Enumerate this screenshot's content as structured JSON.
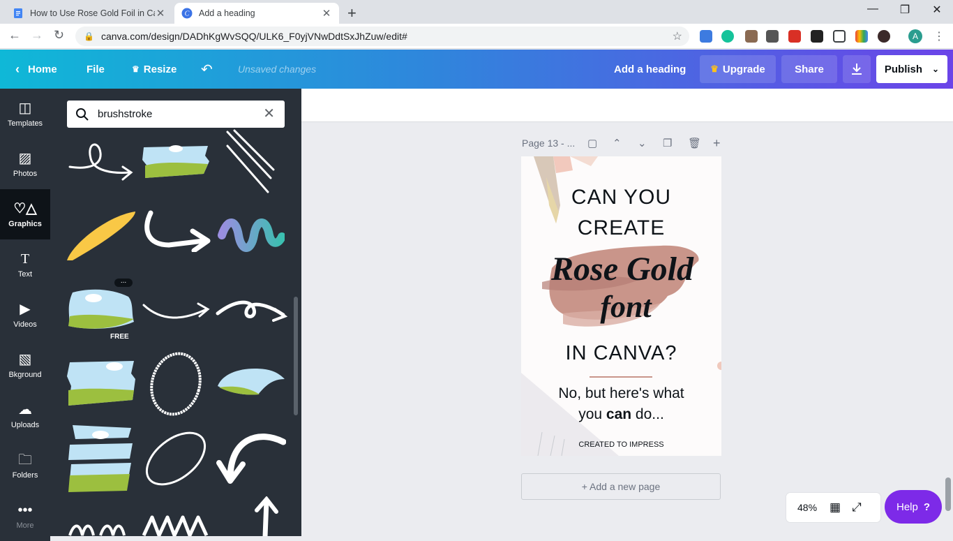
{
  "browser": {
    "tabs": [
      {
        "title": "How to Use Rose Gold Foil in Can",
        "active": false
      },
      {
        "title": "Add a heading",
        "active": true
      }
    ],
    "url": "canva.com/design/DADhKgWvSQQ/ULK6_F0yjVNwDdtSxJhZuw/edit#",
    "profile_initial": "A"
  },
  "header": {
    "home": "Home",
    "file": "File",
    "resize": "Resize",
    "unsaved": "Unsaved changes",
    "design_title": "Add a heading",
    "upgrade": "Upgrade",
    "share": "Share",
    "publish": "Publish"
  },
  "rail": [
    "Templates",
    "Photos",
    "Graphics",
    "Text",
    "Videos",
    "Bkground",
    "Uploads",
    "Folders",
    "More"
  ],
  "panel": {
    "search_value": "brushstroke",
    "free_badge": "FREE",
    "more_badge": "..."
  },
  "editor": {
    "page_label": "Page 13 - ...",
    "add_page": "+ Add a new page",
    "zoom": "48%",
    "help": "Help"
  },
  "design": {
    "line1": "CAN YOU",
    "line2": "CREATE",
    "script1": "Rose Gold",
    "script2": "font",
    "line3": "IN CANVA?",
    "sub1": "No, but here's what",
    "sub2_pre": "you ",
    "sub2_bold": "can",
    "sub2_post": " do...",
    "footer": "CREATED TO IMPRESS"
  },
  "colors": {
    "header_start": "#0fb8d7",
    "header_end": "#6b44e8",
    "help": "#7d2ae8",
    "rose_gold": "#c9958a",
    "panel_bg": "#293039"
  }
}
